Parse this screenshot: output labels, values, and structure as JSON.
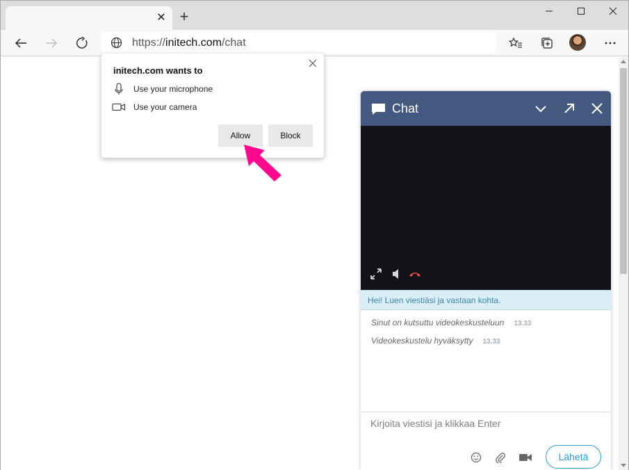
{
  "browser": {
    "tab": {
      "close_glyph": "✕"
    },
    "new_tab_glyph": "+",
    "address": {
      "scheme": "https://",
      "host": "initech.com",
      "path": "/chat"
    }
  },
  "permission_popup": {
    "title": "initech.com wants to",
    "permissions": [
      {
        "label": "Use your microphone",
        "icon": "microphone-icon"
      },
      {
        "label": "Use your camera",
        "icon": "camera-icon"
      }
    ],
    "allow_label": "Allow",
    "block_label": "Block",
    "pointer_color": "#ff0a8f"
  },
  "chat": {
    "title": "Chat",
    "header_color": "#44597f",
    "notice": "Hei! Luen viestiäsi ja vastaan kohta.",
    "messages": [
      {
        "text": "Sinut on kutsuttu videokeskusteluun",
        "time": "13.33"
      },
      {
        "text": "Videokeskustelu hyväksytty",
        "time": "13.33"
      }
    ],
    "composer_placeholder": "Kirjoita viestisi ja klikkaa Enter",
    "send_label": "Lähetä",
    "accent_color": "#2d9bd6"
  }
}
